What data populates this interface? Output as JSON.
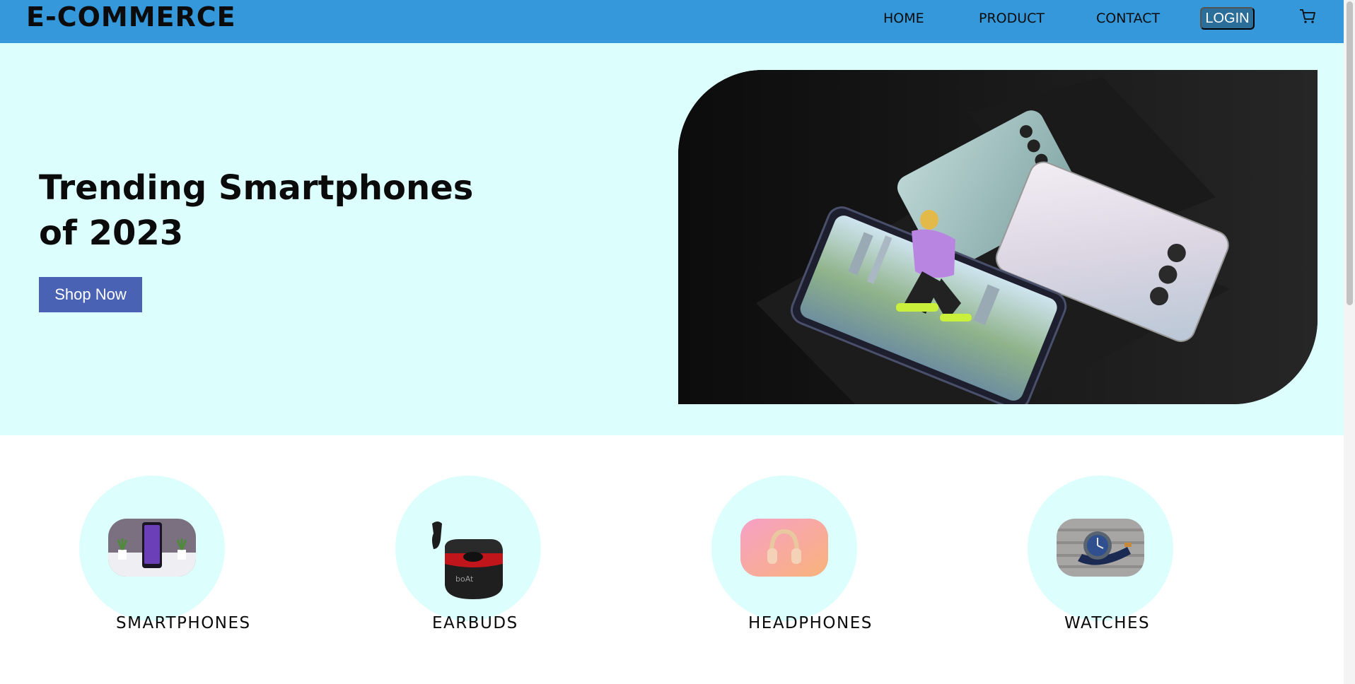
{
  "header": {
    "brand": "E-COMMERCE",
    "nav": {
      "home": "HOME",
      "product": "PRODUCT",
      "contact": "CONTACT",
      "login": "LOGIN"
    },
    "cart_icon": "cart-icon",
    "colors": {
      "bar": "#3498db",
      "login_bg": "#2b6e99"
    }
  },
  "hero": {
    "title": "Trending Smartphones of 2023",
    "button": "Shop Now",
    "colors": {
      "background": "#dcfffe",
      "button": "#4a62b4"
    }
  },
  "categories": [
    {
      "label": "SMARTPHONES"
    },
    {
      "label": "EARBUDS"
    },
    {
      "label": "HEADPHONES"
    },
    {
      "label": "WATCHES"
    }
  ]
}
